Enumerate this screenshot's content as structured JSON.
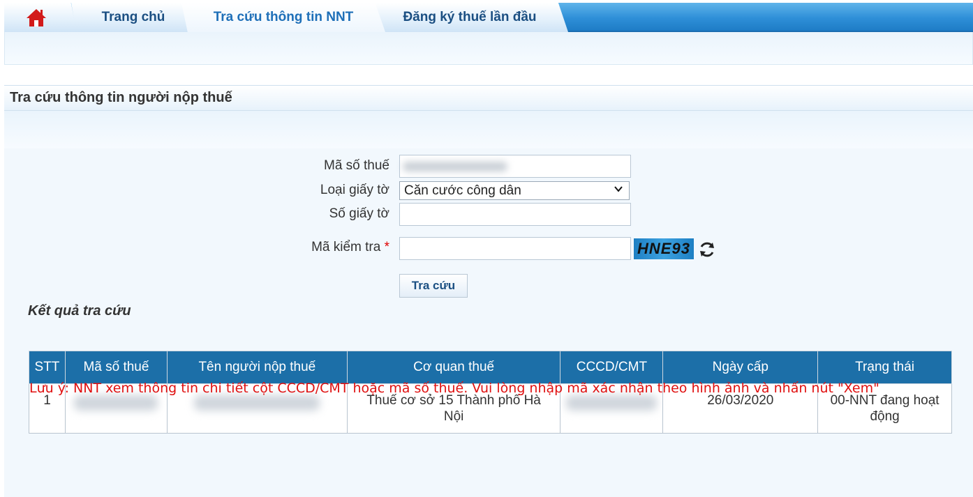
{
  "nav": {
    "home_icon": "home-icon",
    "tabs": [
      {
        "label": "Trang chủ"
      },
      {
        "label": "Tra cứu thông tin NNT"
      },
      {
        "label": "Đăng ký thuế lần đầu"
      }
    ],
    "accent": "#1e7cc6"
  },
  "panel": {
    "title": "Tra cứu thông tin người nộp thuế"
  },
  "form": {
    "tax_code_label": "Mã số thuế",
    "tax_code_value": "",
    "doc_type_label": "Loại giấy tờ",
    "doc_type_selected": "Căn cước công dân",
    "doc_number_label": "Số giấy tờ",
    "doc_number_value": "",
    "captcha_label": "Mã kiểm tra",
    "required_mark": "*",
    "captcha_value": "",
    "captcha_image_text": "HNE93",
    "submit_label": "Tra cứu"
  },
  "results": {
    "title": "Kết quả tra cứu",
    "columns": [
      "STT",
      "Mã số thuế",
      "Tên người nộp thuế",
      "Cơ quan thuế",
      "CCCD/CMT",
      "Ngày cấp",
      "Trạng thái"
    ],
    "rows": [
      {
        "stt": "1",
        "tax_code": "",
        "name": "",
        "agency": "Thuế cơ sở 15 Thành phố Hà Nội",
        "id_number": "",
        "issue_date": "26/03/2020",
        "status": "00-NNT đang hoạt động"
      }
    ]
  },
  "note": "Lưu ý: NNT xem thông tin chi tiết cột CCCD/CMT hoặc mã số thuế. Vui lòng nhập mã xác nhận theo hình ảnh và nhấn nút \"Xem\""
}
